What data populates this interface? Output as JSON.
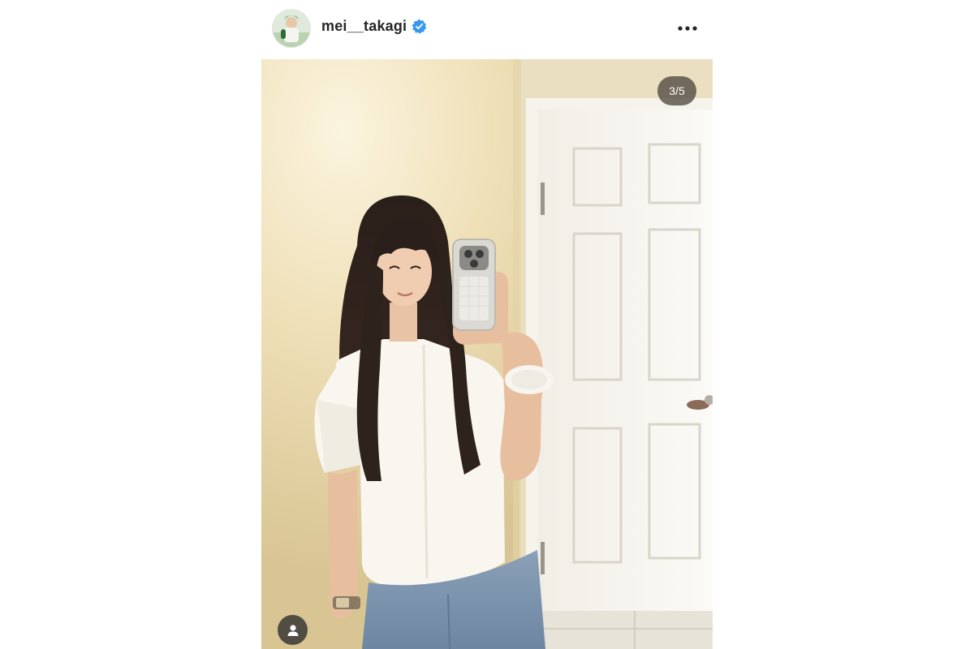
{
  "post": {
    "username": "mei__takagi",
    "verified": true,
    "icons": {
      "avatar": "profile-avatar",
      "verified": "verified-badge-icon",
      "more": "more-options-icon",
      "tag": "tagged-user-icon"
    },
    "colors": {
      "verified_blue": "#3897f0",
      "text": "#262626"
    }
  },
  "media": {
    "carousel_counter": "3/5",
    "description_hidden": ""
  }
}
